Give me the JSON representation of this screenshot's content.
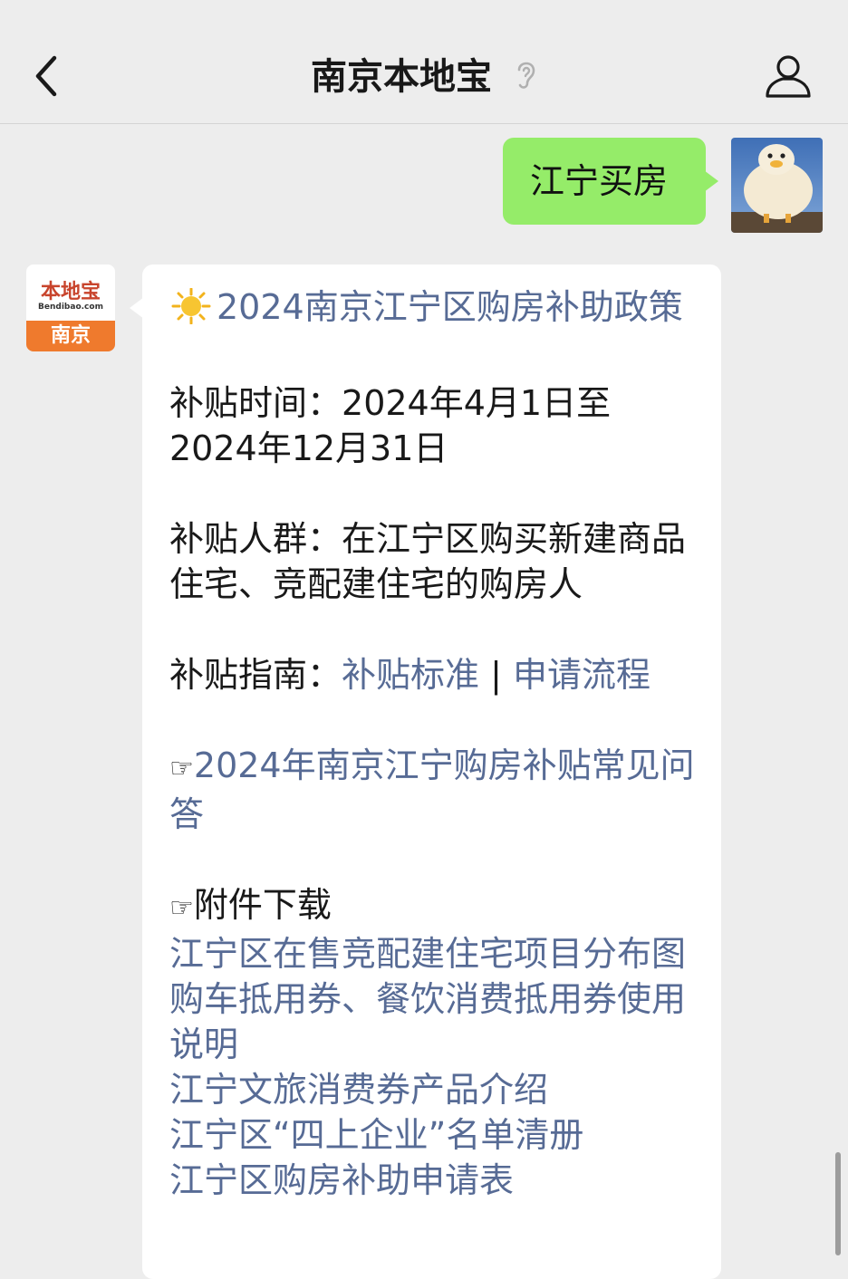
{
  "header": {
    "title": "南京本地宝"
  },
  "user_message": {
    "text": "江宁买房"
  },
  "bot_avatar": {
    "logo_text": "本地宝",
    "logo_url": "Bendibao.com",
    "city": "南京"
  },
  "reply": {
    "headline": "2024南京江宁区购房补助政策",
    "time_label": "补贴时间：",
    "time_value": "2024年4月1日至2024年12月31日",
    "people_label": "补贴人群：",
    "people_value": "在江宁区购买新建商品住宅、竞配建住宅的购房人",
    "guide_label": "补贴指南：",
    "guide_link1": "补贴标准",
    "guide_sep": " | ",
    "guide_link2": "申请流程",
    "faq_link": "2024年南京江宁购房补贴常见问答",
    "hand_icon": "☞",
    "attach_label": "附件下载",
    "attachments": [
      "江宁区在售竞配建住宅项目分布图",
      "购车抵用券、餐饮消费抵用券使用说明",
      "江宁文旅消费券产品介绍",
      "江宁区“四上企业”名单清册",
      "江宁区购房补助申请表"
    ]
  },
  "icons": {
    "back": "chevron-left-icon",
    "ear": "ear-icon",
    "profile": "user-icon",
    "sun": "sun-icon"
  },
  "colors": {
    "background": "#ededed",
    "my_bubble": "#95ec69",
    "link": "#576b95",
    "logo_orange": "#ef7a2d"
  }
}
